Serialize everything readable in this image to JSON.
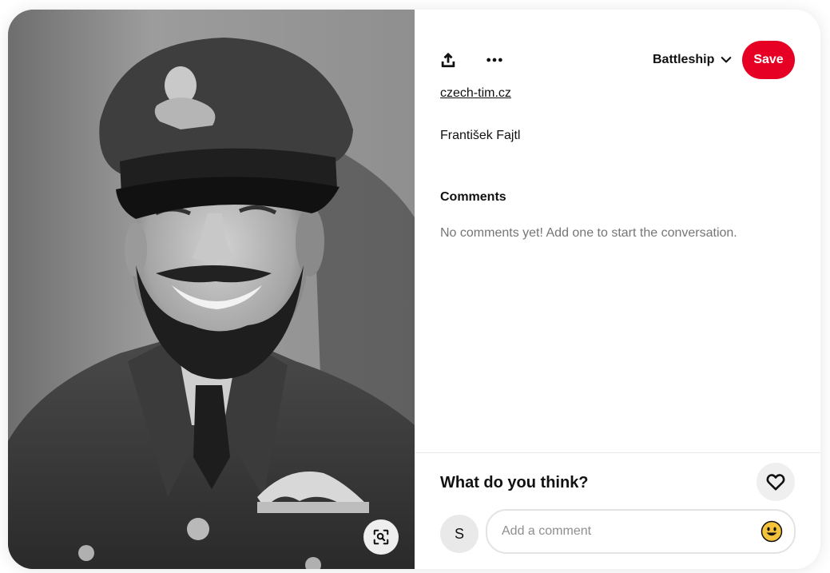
{
  "pin": {
    "image_alt": "Black and white portrait of a smiling bearded officer in RAF uniform and cap",
    "source_link": "czech-tim.cz",
    "title": "František Fajtl"
  },
  "toolbar": {
    "share_icon": "share-icon",
    "more_icon": "ellipsis-icon",
    "board_name": "Battleship",
    "save_label": "Save"
  },
  "comments": {
    "heading": "Comments",
    "empty_text": "No comments yet! Add one to start the conversation."
  },
  "footer": {
    "prompt": "What do you think?",
    "avatar_initial": "S",
    "comment_placeholder": "Add a comment",
    "react_icon": "heart-icon",
    "emoji_icon": "smiley-emoji-icon"
  },
  "colors": {
    "brand_red": "#e60023",
    "text_primary": "#111111",
    "text_secondary": "#767676"
  }
}
